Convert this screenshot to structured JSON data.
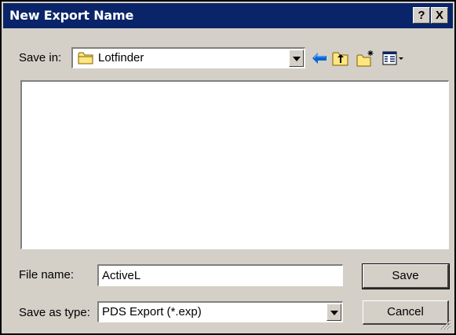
{
  "window": {
    "title": "New Export Name",
    "help_button": "?",
    "close_button": "X"
  },
  "save_in": {
    "label": "Save in:",
    "value": "Lotfinder"
  },
  "toolbar": {
    "icons": [
      "back-arrow-icon",
      "up-one-level-icon",
      "create-new-folder-icon",
      "view-menu-icon"
    ]
  },
  "file_list": {
    "items": []
  },
  "file_name": {
    "label": "File name:",
    "value": "ActiveL"
  },
  "save_as_type": {
    "label": "Save as type:",
    "value": "PDS Export (*.exp)"
  },
  "buttons": {
    "save": "Save",
    "cancel": "Cancel"
  },
  "colors": {
    "titlebar": "#0a246a",
    "face": "#d4d0c8",
    "folder": "#ffe680"
  }
}
